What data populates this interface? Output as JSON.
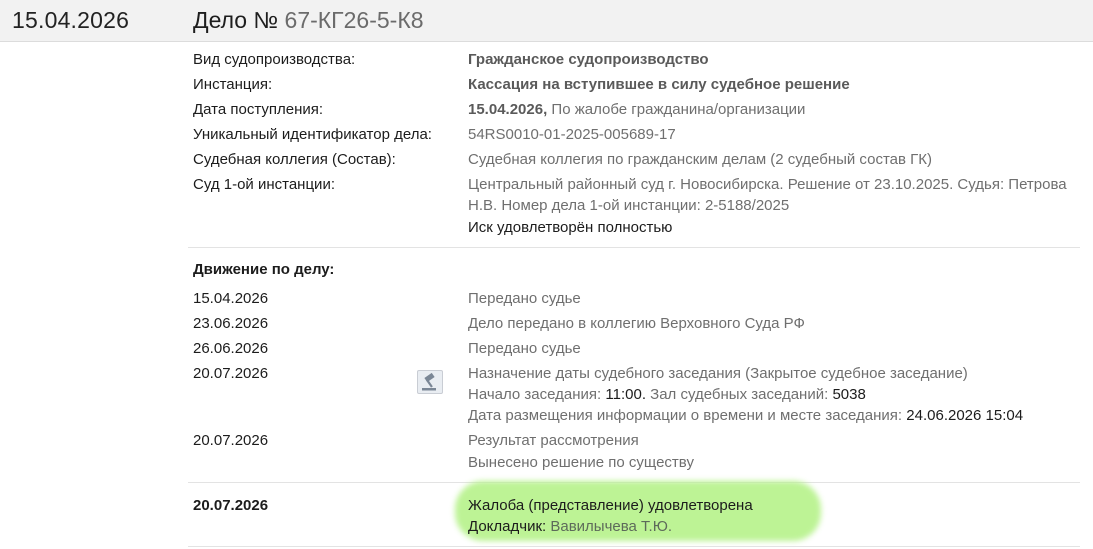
{
  "header": {
    "date": "15.04.2026",
    "case_label": "Дело №",
    "case_number": "67-КГ26-5-К8"
  },
  "details": {
    "proceeding_type_label": "Вид судопроизводства:",
    "proceeding_type_value": "Гражданское судопроизводство",
    "instance_label": "Инстанция:",
    "instance_value": "Кассация на вступившее в силу судебное решение",
    "receipt_date_label": "Дата поступления:",
    "receipt_date_value": "15.04.2026,",
    "receipt_source": "По жалобе гражданина/организации",
    "uid_label": "Уникальный идентификатор дела:",
    "uid_value": "54RS0010-01-2025-005689-17",
    "collegium_label": "Судебная коллегия (Состав):",
    "collegium_value": "Судебная коллегия по гражданским делам  (2 судебный состав ГК)",
    "first_instance_label": "Суд 1-ой инстанции:",
    "first_instance_line1": "Центральный районный суд г. Новосибирска. Решение от 23.10.2025.  Судья: Петрова",
    "first_instance_line2": "Н.В. Номер дела 1-ой инстанции: 2-5188/2025",
    "first_instance_result": "Иск удовлетворён полностью"
  },
  "movement": {
    "title": "Движение по делу:",
    "events": [
      {
        "date": "15.04.2026",
        "text": "Передано судье"
      },
      {
        "date": "23.06.2026",
        "text": "Дело передано в коллегию Верховного Суда РФ"
      },
      {
        "date": "26.06.2026",
        "text": "Передано судье"
      },
      {
        "date": "20.07.2026",
        "text": "Назначение даты судебного заседания (Закрытое судебное заседание)",
        "start_label": "Начало заседания:",
        "start_value": "11:00.",
        "hall_label": "Зал судебных заседаний:",
        "hall_value": "5038",
        "posted_label": "Дата размещения информации о времени и месте заседания:",
        "posted_value": "24.06.2026 15:04",
        "icon": "gavel-icon"
      },
      {
        "date": "20.07.2026",
        "text": "Результат рассмотрения",
        "text2": "Вынесено решение по существу"
      }
    ],
    "final": {
      "date": "20.07.2026",
      "text": "Жалоба (представление) удовлетворена",
      "reporter_label": "Докладчик:",
      "reporter_value": "Вавилычева Т.Ю.",
      "highlight_color": "#b6f28a"
    }
  }
}
